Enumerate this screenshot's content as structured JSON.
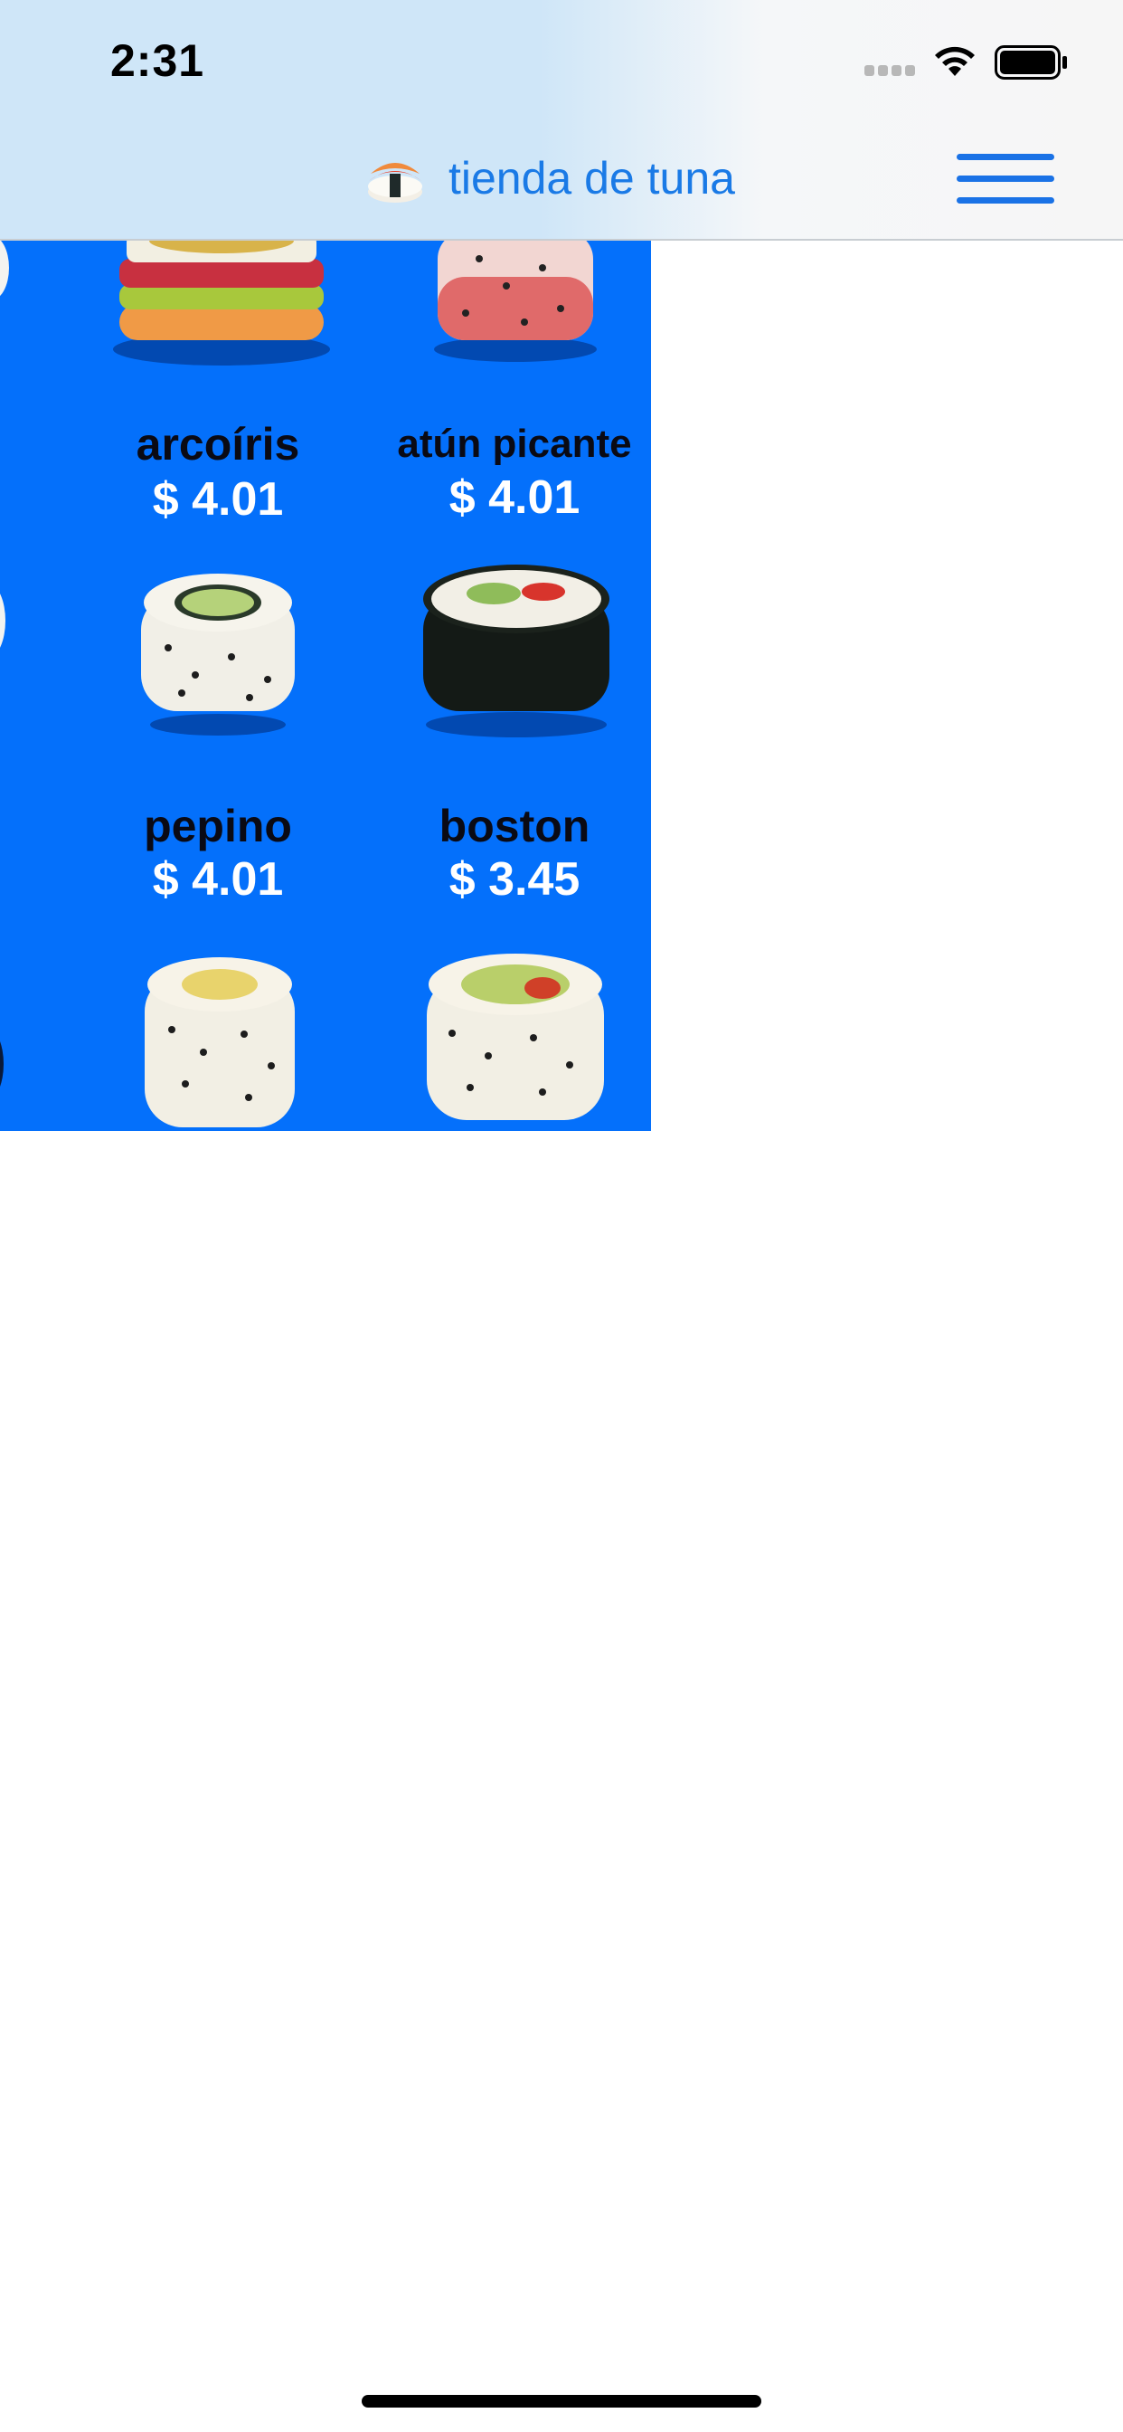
{
  "status_bar": {
    "time": "2:31"
  },
  "nav": {
    "title": "tienda de tuna",
    "logo_icon": "sushi-icon",
    "menu_icon": "hamburger-menu-icon"
  },
  "colors": {
    "panel_blue": "#0470fb",
    "accent_blue": "#1a7ae6"
  },
  "products": [
    {
      "name": "arcoíris",
      "price": "$ 4.01"
    },
    {
      "name": "atún picante",
      "price": "$ 4.01"
    },
    {
      "name": "pepino",
      "price": "$ 4.01"
    },
    {
      "name": "boston",
      "price": "$ 3.45"
    }
  ]
}
